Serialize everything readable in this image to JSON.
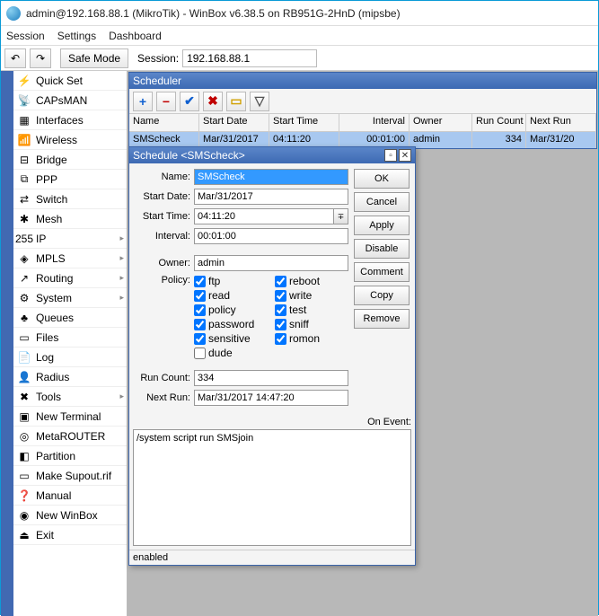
{
  "window": {
    "title": "admin@192.168.88.1 (MikroTik) - WinBox v6.38.5 on RB951G-2HnD (mipsbe)"
  },
  "menu": {
    "session": "Session",
    "settings": "Settings",
    "dashboard": "Dashboard"
  },
  "toolbar": {
    "safe_mode": "Safe Mode",
    "session_label": "Session:",
    "session_value": "192.168.88.1"
  },
  "sidebar": [
    {
      "label": "Quick Set",
      "icon": "⚡",
      "more": false
    },
    {
      "label": "CAPsMAN",
      "icon": "📡",
      "more": false
    },
    {
      "label": "Interfaces",
      "icon": "▦",
      "more": false
    },
    {
      "label": "Wireless",
      "icon": "📶",
      "more": false
    },
    {
      "label": "Bridge",
      "icon": "⊟",
      "more": false
    },
    {
      "label": "PPP",
      "icon": "⧉",
      "more": false
    },
    {
      "label": "Switch",
      "icon": "⇄",
      "more": false
    },
    {
      "label": "Mesh",
      "icon": "✱",
      "more": false
    },
    {
      "label": "IP",
      "icon": "255",
      "more": true
    },
    {
      "label": "MPLS",
      "icon": "◈",
      "more": true
    },
    {
      "label": "Routing",
      "icon": "↗",
      "more": true
    },
    {
      "label": "System",
      "icon": "⚙",
      "more": true
    },
    {
      "label": "Queues",
      "icon": "♣",
      "more": false
    },
    {
      "label": "Files",
      "icon": "▭",
      "more": false
    },
    {
      "label": "Log",
      "icon": "📄",
      "more": false
    },
    {
      "label": "Radius",
      "icon": "👤",
      "more": false
    },
    {
      "label": "Tools",
      "icon": "✖",
      "more": true
    },
    {
      "label": "New Terminal",
      "icon": "▣",
      "more": false
    },
    {
      "label": "MetaROUTER",
      "icon": "◎",
      "more": false
    },
    {
      "label": "Partition",
      "icon": "◧",
      "more": false
    },
    {
      "label": "Make Supout.rif",
      "icon": "▭",
      "more": false
    },
    {
      "label": "Manual",
      "icon": "❓",
      "more": false
    },
    {
      "label": "New WinBox",
      "icon": "◉",
      "more": false
    },
    {
      "label": "Exit",
      "icon": "⏏",
      "more": false
    }
  ],
  "scheduler": {
    "title": "Scheduler",
    "cols": {
      "name": "Name",
      "start_date": "Start Date",
      "start_time": "Start Time",
      "interval": "Interval",
      "owner": "Owner",
      "run_count": "Run Count",
      "next_run": "Next Run"
    },
    "row": {
      "name": "SMScheck",
      "start_date": "Mar/31/2017",
      "start_time": "04:11:20",
      "interval": "00:01:00",
      "owner": "admin",
      "run_count": "334",
      "next_run": "Mar/31/20"
    }
  },
  "dialog": {
    "title": "Schedule <SMScheck>",
    "labels": {
      "name": "Name:",
      "start_date": "Start Date:",
      "start_time": "Start Time:",
      "interval": "Interval:",
      "owner": "Owner:",
      "policy": "Policy:",
      "run_count": "Run Count:",
      "next_run": "Next Run:",
      "on_event": "On Event:"
    },
    "values": {
      "name": "SMScheck",
      "start_date": "Mar/31/2017",
      "start_time": "04:11:20",
      "interval": "00:01:00",
      "owner": "admin",
      "run_count": "334",
      "next_run": "Mar/31/2017 14:47:20",
      "on_event": "/system script run SMSjoin"
    },
    "policy": [
      {
        "label": "ftp",
        "checked": true
      },
      {
        "label": "reboot",
        "checked": true
      },
      {
        "label": "read",
        "checked": true
      },
      {
        "label": "write",
        "checked": true
      },
      {
        "label": "policy",
        "checked": true
      },
      {
        "label": "test",
        "checked": true
      },
      {
        "label": "password",
        "checked": true
      },
      {
        "label": "sniff",
        "checked": true
      },
      {
        "label": "sensitive",
        "checked": true
      },
      {
        "label": "romon",
        "checked": true
      },
      {
        "label": "dude",
        "checked": false
      }
    ],
    "buttons": {
      "ok": "OK",
      "cancel": "Cancel",
      "apply": "Apply",
      "disable": "Disable",
      "comment": "Comment",
      "copy": "Copy",
      "remove": "Remove"
    },
    "status": "enabled"
  }
}
